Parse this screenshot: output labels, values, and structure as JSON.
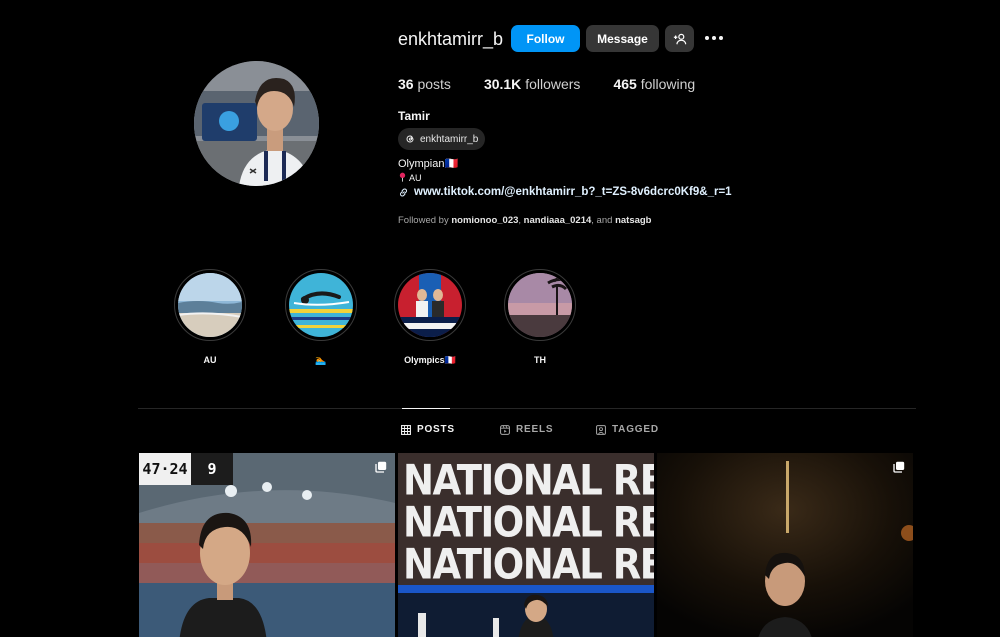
{
  "profile": {
    "username": "enkhtamirr_b",
    "full_name": "Tamir",
    "threads_handle": "enkhtamirr_b",
    "bio_line1": "Olympian🇫🇷",
    "bio_line2": "AU",
    "link": "www.tiktok.com/@enkhtamirr_b?_t=ZS-8v6dcrc0Kf9&_r=1"
  },
  "actions": {
    "follow": "Follow",
    "message": "Message"
  },
  "stats": {
    "posts_count": "36",
    "posts_label": "posts",
    "followers_count": "30.1K",
    "followers_label": "followers",
    "following_count": "465",
    "following_label": "following"
  },
  "followed_by": {
    "prefix": "Followed by",
    "users": [
      "nomionoo_023",
      "nandiaaa_0214",
      "natsagb"
    ],
    "sep1": ",",
    "sep2": ", and"
  },
  "highlights": [
    {
      "label": "AU"
    },
    {
      "label": "🏊"
    },
    {
      "label": "Olympics🇫🇷"
    },
    {
      "label": "TH"
    }
  ],
  "tabs": {
    "posts": "POSTS",
    "reels": "REELS",
    "tagged": "TAGGED"
  },
  "posts": {
    "post1_score": "47·24",
    "post1_lane": "9",
    "post2_text": "NATIONAL RECORD"
  },
  "colors": {
    "follow_button": "#0095f6",
    "secondary_button": "#363636",
    "background": "#000000"
  }
}
